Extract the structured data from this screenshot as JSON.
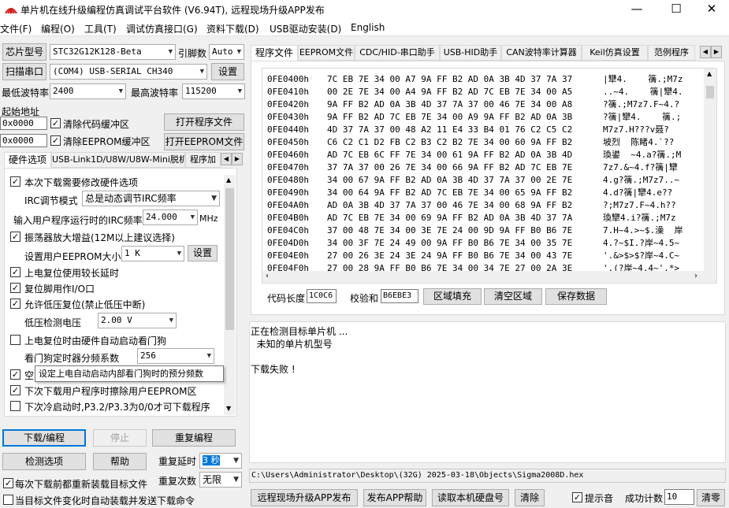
{
  "window": {
    "title": "单片机在线升级编程仿真调试平台软件 (V6.94T), 远程现场升级APP发布",
    "min_label": "—",
    "max_label": "☐",
    "close_label": "✕"
  },
  "menu": [
    "文件(F)",
    "编程(O)",
    "工具(T)",
    "调试仿真接口(G)",
    "资料下载(D)",
    "USB驱动安装(D)",
    "English"
  ],
  "left": {
    "chip_label": "芯片型号",
    "chip_value": "STC32G12K128-Beta",
    "pin_label": "引脚数",
    "pin_value": "Auto",
    "scan_btn": "扫描串口",
    "port_value": "(COM4) USB-SERIAL CH340",
    "settings_btn": "设置",
    "min_baud_label": "最低波特率",
    "min_baud_value": "2400",
    "max_baud_label": "最高波特率",
    "max_baud_value": "115200",
    "start_addr_label": "起始地址",
    "addr1": "0x0000",
    "clear_code_label": "清除代码缓冲区",
    "open_prog_btn": "打开程序文件",
    "addr2": "0x0000",
    "clear_eeprom_label": "清除EEPROM缓冲区",
    "open_eeprom_btn": "打开EEPROM文件",
    "tabs": [
      "硬件选项",
      "USB-Link1D/U8W/U8W-Mini脱机",
      "程序加"
    ],
    "options": {
      "opt1": "本次下载需要修改硬件选项",
      "irc_mode_label": "IRC调节模式",
      "irc_mode_value": "总是动态调节IRC频率",
      "irc_freq_label": "输入用户程序运行时的IRC频率",
      "irc_freq_value": "24.000",
      "irc_unit": "MHz",
      "osc_label": "振荡器放大增益(12M以上建议选择)",
      "eeprom_size_label": "设置用户EEPROM大小",
      "eeprom_size_value": "1   K",
      "eeprom_set_btn": "设置",
      "long_delay_label": "上电复位使用较长延时",
      "reset_pin_label": "复位脚用作I/O口",
      "lvr_label": "允许低压复位(禁止低压中断)",
      "lv_detect_label": "低压检测电压",
      "lv_detect_value": "2.00 V",
      "wdt_label": "上电复位时由硬件自动启动看门狗",
      "wdt_div_label": "看门狗定时器分频系数",
      "wdt_div_value": "256",
      "empty_label": "空",
      "tooltip": "设定上电自动启动内部看门狗时的预分频数",
      "erase_eeprom_label": "下次下载用户程序时擦除用户EEPROM区",
      "cold_boot_label": "下次冷启动时,P3.2/P3.3为0/0才可下载程序"
    },
    "download_btn": "下载/编程",
    "stop_btn": "停止",
    "reprogram_btn": "重复编程",
    "check_btn": "检测选项",
    "help_btn": "帮助",
    "repeat_delay_label": "重复延时",
    "repeat_delay_value": "3 秒",
    "reload_label": "每次下载前都重新装载目标文件",
    "repeat_count_label": "重复次数",
    "repeat_count_value": "无限",
    "auto_send_label": "当目标文件变化时自动装载并发送下载命令"
  },
  "right": {
    "tabs": [
      "程序文件",
      "EEPROM文件",
      "CDC/HID-串口助手",
      "USB-HID助手",
      "CAN波特率计算器",
      "Keil仿真设置",
      "范例程序"
    ],
    "hex_rows": [
      {
        "addr": "0FE0400h",
        "bytes": "7C EB 7E 34 00 A7 9A FF B2 AD 0A 3B 4D 37 7A 37",
        "ascii": "|犫4.    篟.;M7z"
      },
      {
        "addr": "0FE0410h",
        "bytes": "00 2E 7E 34 00 A4 9A FF B2 AD 7C EB 7E 34 00 A5",
        "ascii": "..~4.    篟|犫4."
      },
      {
        "addr": "0FE0420h",
        "bytes": "9A FF B2 AD 0A 3B 4D 37 7A 37 00 46 7E 34 00 A8",
        "ascii": "?篟.;M7z7.F~4.?"
      },
      {
        "addr": "0FE0430h",
        "bytes": "9A FF B2 AD 7C EB 7E 34 00 A9 9A FF B2 AD 0A 3B",
        "ascii": "?篟|犫4.    篟.;"
      },
      {
        "addr": "0FE0440h",
        "bytes": "4D 37 7A 37 00 48 A2 11 E4 33 B4 01 76 C2 C5 C2",
        "ascii": "M7z7.H???v聂?"
      },
      {
        "addr": "0FE0450h",
        "bytes": "C6 C2 C1 D2 FB C2 B3 C2 B2 7E 34 00 60 9A FF B2",
        "ascii": "坡烈  陈睹4.`??"
      },
      {
        "addr": "0FE0460h",
        "bytes": "AD 7C EB 6C FF 7E 34 00 61 9A FF B2 AD 0A 3B 4D",
        "ascii": "瑍鍙  ~4.a?篟.;M"
      },
      {
        "addr": "0FE0470h",
        "bytes": "37 7A 37 00 26 7E 34 00 66 9A FF B2 AD 7C EB 7E",
        "ascii": "7z7.&~4.f?篟|犫"
      },
      {
        "addr": "0FE0480h",
        "bytes": "34 00 67 9A FF B2 AD 0A 3B 4D 37 7A 37 00 2E 7E",
        "ascii": "4.g?篟.;M7z7..~"
      },
      {
        "addr": "0FE0490h",
        "bytes": "34 00 64 9A FF B2 AD 7C EB 7E 34 00 65 9A FF B2",
        "ascii": "4.d?篟|犫4.e??"
      },
      {
        "addr": "0FE04A0h",
        "bytes": "AD 0A 3B 4D 37 7A 37 00 46 7E 34 00 68 9A FF B2",
        "ascii": "?;M7z7.F~4.h??"
      },
      {
        "addr": "0FE04B0h",
        "bytes": "AD 7C EB 7E 34 00 69 9A FF B2 AD 0A 3B 4D 37 7A",
        "ascii": "瑍犫4.i?篟.;M7z"
      },
      {
        "addr": "0FE04C0h",
        "bytes": "37 00 48 7E 34 00 3E 7E 24 00 9D 9A FF B0 B6 7E",
        "ascii": "7.H~4.>~$.澡  岸"
      },
      {
        "addr": "0FE04D0h",
        "bytes": "34 00 3F 7E 24 49 00 9A FF B0 B6 7E 34 00 35 7E",
        "ascii": "4.?~$I.?岸~4.5~"
      },
      {
        "addr": "0FE04E0h",
        "bytes": "27 00 26 3E 24 3E 24 9A FF B0 B6 7E 34 00 43 7E",
        "ascii": "'.&>$>$?岸~4.C~"
      },
      {
        "addr": "0FE04F0h",
        "bytes": "27 00 28 9A FF B0 B6 7E 34 00 34 7E 27 00 2A 3E",
        "ascii": "'.(?岸~4.4~'.*>"
      }
    ],
    "code_len_label": "代码长度",
    "code_len_value": "1C0C6",
    "checksum_label": "校验和",
    "checksum_value": "B6EBE3",
    "fill_btn": "区域填充",
    "clear_btn": "清空区域",
    "save_btn": "保存数据",
    "log": [
      "正在检测目标单片机 ...",
      "  未知的单片机型号",
      "",
      "下载失败 !"
    ],
    "file_path": "C:\\Users\\Administrator\\Desktop\\(32G)  2025-03-18\\Objects\\Sigma2008D.hex",
    "remote_btn": "远程现场升级APP发布",
    "publish_help_btn": "发布APP帮助",
    "read_disk_btn": "读取本机硬盘号",
    "clear_log_btn": "清除",
    "beep_label": "提示音",
    "success_label": "成功计数",
    "success_value": "10",
    "zero_btn": "清零"
  }
}
